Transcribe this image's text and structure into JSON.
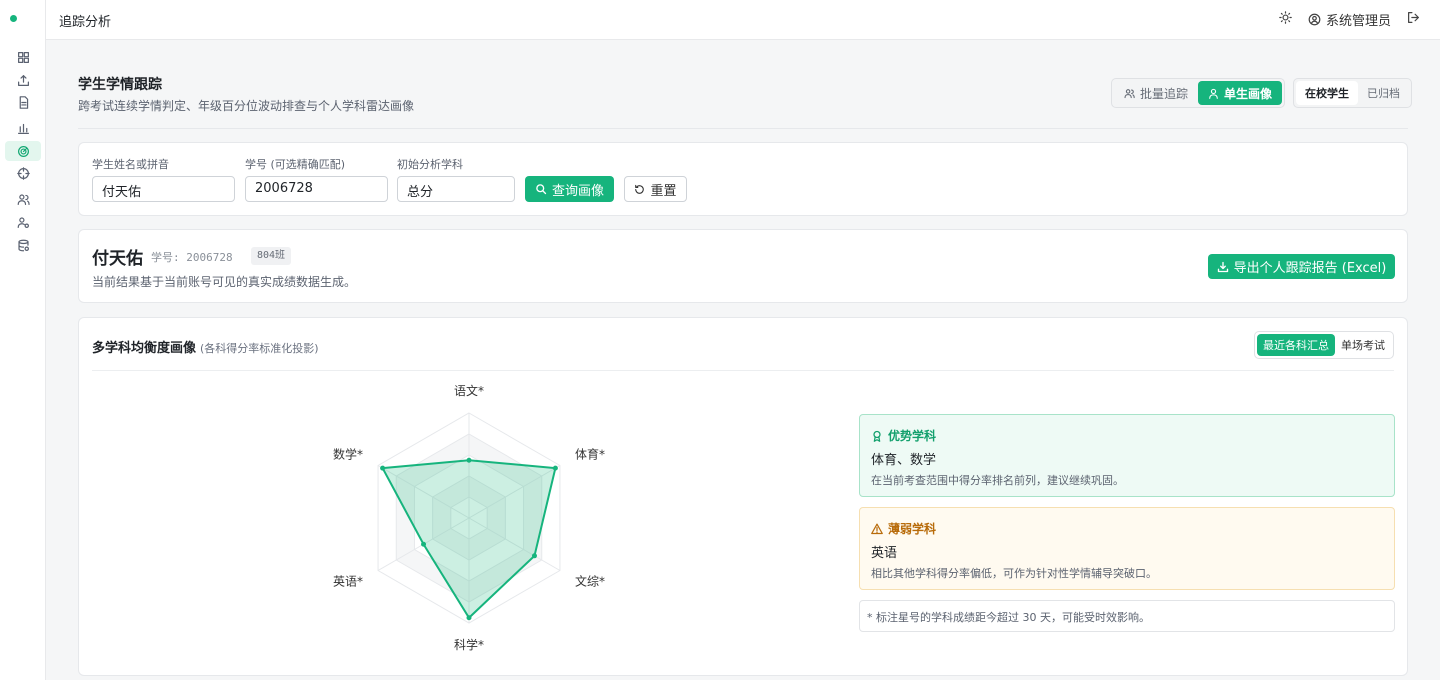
{
  "topbar": {
    "title": "追踪分析",
    "user": "系统管理员",
    "icons": [
      "sun-icon",
      "user-circle-icon",
      "logout-icon"
    ]
  },
  "sidebar": {
    "items": [
      "dashboard-icon",
      "upload-icon",
      "document-icon",
      "bar-chart-icon",
      "radar-icon",
      "crosshair-icon",
      "users-icon",
      "user-settings-icon",
      "database-icon"
    ],
    "active_index": 4
  },
  "header": {
    "title": "学生学情跟踪",
    "subtitle": "跨考试连续学情判定、年级百分位波动排查与个人学科雷达画像",
    "mode_tabs": [
      "批量追踪",
      "单生画像"
    ],
    "mode_active": "单生画像",
    "status_tabs": [
      "在校学生",
      "已归档"
    ],
    "status_active": "在校学生"
  },
  "search": {
    "name_label": "学生姓名或拼音",
    "name_value": "付天佑",
    "id_label": "学号 (可选精确匹配)",
    "id_value": "2006728",
    "subject_label": "初始分析学科",
    "subject_value": "总分",
    "query_button": "查询画像",
    "reset_button": "重置"
  },
  "student": {
    "name": "付天佑",
    "id_text": "学号: 2006728",
    "class": "804班",
    "note": "当前结果基于当前账号可见的真实成绩数据生成。",
    "export_button": "导出个人跟踪报告 (Excel)"
  },
  "radar": {
    "title": "多学科均衡度画像",
    "hint": "(各科得分率标准化投影)",
    "tabs": [
      "最近各科汇总",
      "单场考试"
    ],
    "tab_active": "最近各科汇总"
  },
  "chart_data": {
    "type": "radar",
    "axes": [
      "语文*",
      "体育*",
      "文综*",
      "科学*",
      "英语*",
      "数学*"
    ],
    "values": [
      0.55,
      0.95,
      0.72,
      0.95,
      0.5,
      0.95
    ],
    "max": 1,
    "grid_levels": 5,
    "color": "#16b47d"
  },
  "insights": {
    "strong_title": "优势学科",
    "strong_subjects": "体育、数学",
    "strong_desc": "在当前考查范围中得分率排名前列，建议继续巩固。",
    "weak_title": "薄弱学科",
    "weak_subjects": "英语",
    "weak_desc": "相比其他学科得分率偏低，可作为针对性学情辅导突破口。",
    "footnote": "* 标注星号的学科成绩距今超过 30 天，可能受时效影响。"
  }
}
